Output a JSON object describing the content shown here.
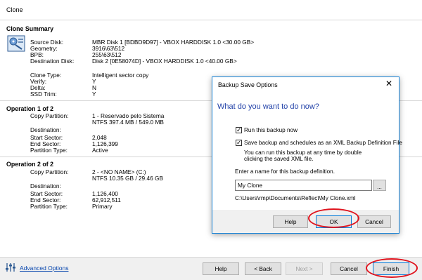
{
  "window": {
    "title": "Clone"
  },
  "summary": {
    "heading": "Clone Summary",
    "source_disk_label": "Source Disk:",
    "source_disk_value": "MBR Disk 1 [BDBD9D97] - VBOX HARDDISK 1.0  <30.00 GB>",
    "geometry_label": "Geometry:",
    "geometry_value": "3916\\63\\512",
    "bpb_label": "BPB:",
    "bpb_value": "255\\63\\512",
    "dest_disk_label": "Destination Disk:",
    "dest_disk_value": " Disk 2 [0E58074D] - VBOX HARDDISK 1.0  <40.00 GB>",
    "clone_type_label": "Clone Type:",
    "clone_type_value": "Intelligent sector copy",
    "verify_label": "Verify:",
    "verify_value": "Y",
    "delta_label": "Delta:",
    "delta_value": "N",
    "ssd_trim_label": "SSD Trim:",
    "ssd_trim_value": "Y"
  },
  "operations": [
    {
      "heading": "Operation 1 of 2",
      "copy_partition_label": "Copy Partition:",
      "copy_partition_value": "1 - Reservado pelo Sistema",
      "copy_partition_detail": "NTFS 397.4 MB / 549.0 MB",
      "destination_label": "Destination:",
      "start_sector_label": "Start Sector:",
      "start_sector_value": "2,048",
      "end_sector_label": "End Sector:",
      "end_sector_value": "1,126,399",
      "partition_type_label": "Partition Type:",
      "partition_type_value": "Active"
    },
    {
      "heading": "Operation 2 of 2",
      "copy_partition_label": "Copy Partition:",
      "copy_partition_value": "2 - <NO NAME> (C:)",
      "copy_partition_detail": "NTFS 10.35 GB / 29.46 GB",
      "destination_label": "Destination:",
      "start_sector_label": "Start Sector:",
      "start_sector_value": "1,126,400",
      "end_sector_label": "End Sector:",
      "end_sector_value": "62,912,511",
      "partition_type_label": "Partition Type:",
      "partition_type_value": "Primary"
    }
  ],
  "footer": {
    "advanced_options": "Advanced Options",
    "help": "Help",
    "back": "< Back",
    "next": "Next >",
    "cancel": "Cancel",
    "finish": "Finish"
  },
  "dialog": {
    "title": "Backup Save Options",
    "close": "✕",
    "question": "What do you want to do now?",
    "run_backup_label": "Run this backup now",
    "run_backup_checked": true,
    "save_xml_label": "Save backup and schedules as an XML Backup Definition File",
    "save_xml_checked": true,
    "save_xml_hint_1": "You can run this backup at any time by double",
    "save_xml_hint_2": "clicking the saved XML file.",
    "name_prompt": "Enter a name for this backup definition.",
    "name_value": "My Clone",
    "browse": "...",
    "path": "C:\\Users\\rmp\\Documents\\Reflect\\My Clone.xml",
    "help": "Help",
    "ok": "OK",
    "cancel": "Cancel"
  },
  "colors": {
    "accent": "#0078d7",
    "highlight_ring": "#e0141e",
    "question": "#1f3fa7",
    "link": "#0645ad"
  }
}
